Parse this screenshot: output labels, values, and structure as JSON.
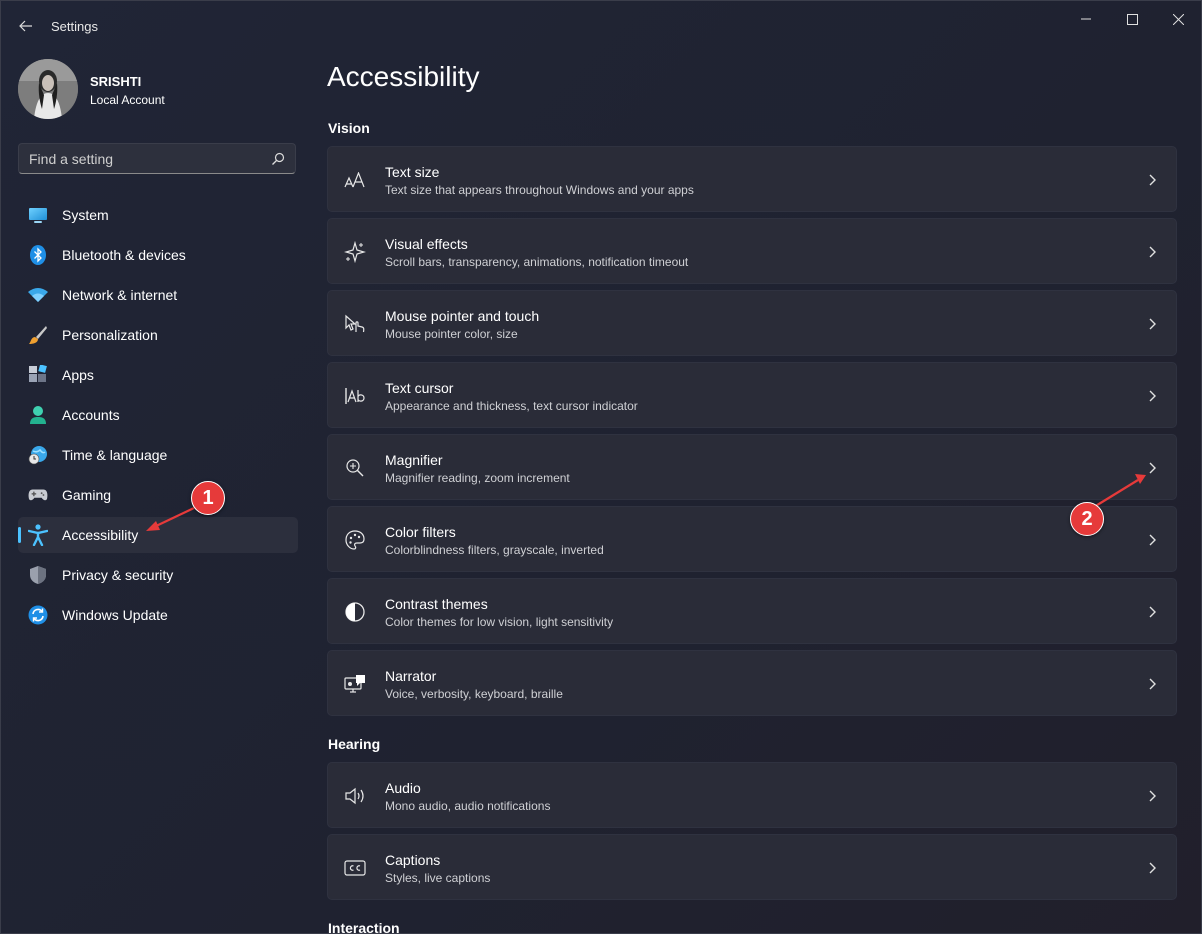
{
  "app": {
    "title": "Settings"
  },
  "profile": {
    "name": "SRISHTI",
    "account_type": "Local Account"
  },
  "search": {
    "placeholder": "Find a setting"
  },
  "nav": {
    "items": [
      {
        "label": "System",
        "icon": "monitor-icon"
      },
      {
        "label": "Bluetooth & devices",
        "icon": "bluetooth-icon"
      },
      {
        "label": "Network & internet",
        "icon": "wifi-icon"
      },
      {
        "label": "Personalization",
        "icon": "paintbrush-icon"
      },
      {
        "label": "Apps",
        "icon": "apps-icon"
      },
      {
        "label": "Accounts",
        "icon": "person-icon"
      },
      {
        "label": "Time & language",
        "icon": "globe-clock-icon"
      },
      {
        "label": "Gaming",
        "icon": "gamepad-icon"
      },
      {
        "label": "Accessibility",
        "icon": "accessibility-icon",
        "active": true
      },
      {
        "label": "Privacy & security",
        "icon": "shield-icon"
      },
      {
        "label": "Windows Update",
        "icon": "update-icon"
      }
    ]
  },
  "main": {
    "title": "Accessibility",
    "sections": {
      "vision": "Vision",
      "hearing": "Hearing",
      "interaction": "Interaction"
    },
    "vision_cards": [
      {
        "title": "Text size",
        "desc": "Text size that appears throughout Windows and your apps",
        "icon": "text-size-icon"
      },
      {
        "title": "Visual effects",
        "desc": "Scroll bars, transparency, animations, notification timeout",
        "icon": "sparkle-icon"
      },
      {
        "title": "Mouse pointer and touch",
        "desc": "Mouse pointer color, size",
        "icon": "pointer-touch-icon"
      },
      {
        "title": "Text cursor",
        "desc": "Appearance and thickness, text cursor indicator",
        "icon": "text-cursor-icon"
      },
      {
        "title": "Magnifier",
        "desc": "Magnifier reading, zoom increment",
        "icon": "magnifier-icon"
      },
      {
        "title": "Color filters",
        "desc": "Colorblindness filters, grayscale, inverted",
        "icon": "palette-icon"
      },
      {
        "title": "Contrast themes",
        "desc": "Color themes for low vision, light sensitivity",
        "icon": "contrast-icon"
      },
      {
        "title": "Narrator",
        "desc": "Voice, verbosity, keyboard, braille",
        "icon": "narrator-icon"
      }
    ],
    "hearing_cards": [
      {
        "title": "Audio",
        "desc": "Mono audio, audio notifications",
        "icon": "speaker-icon"
      },
      {
        "title": "Captions",
        "desc": "Styles, live captions",
        "icon": "captions-icon"
      }
    ]
  },
  "annotations": {
    "badge1": "1",
    "badge2": "2",
    "color": "#e63a3a"
  },
  "colors": {
    "accent": "#4cc2ff",
    "background": "#1f2230",
    "card": "#2a2c38"
  }
}
